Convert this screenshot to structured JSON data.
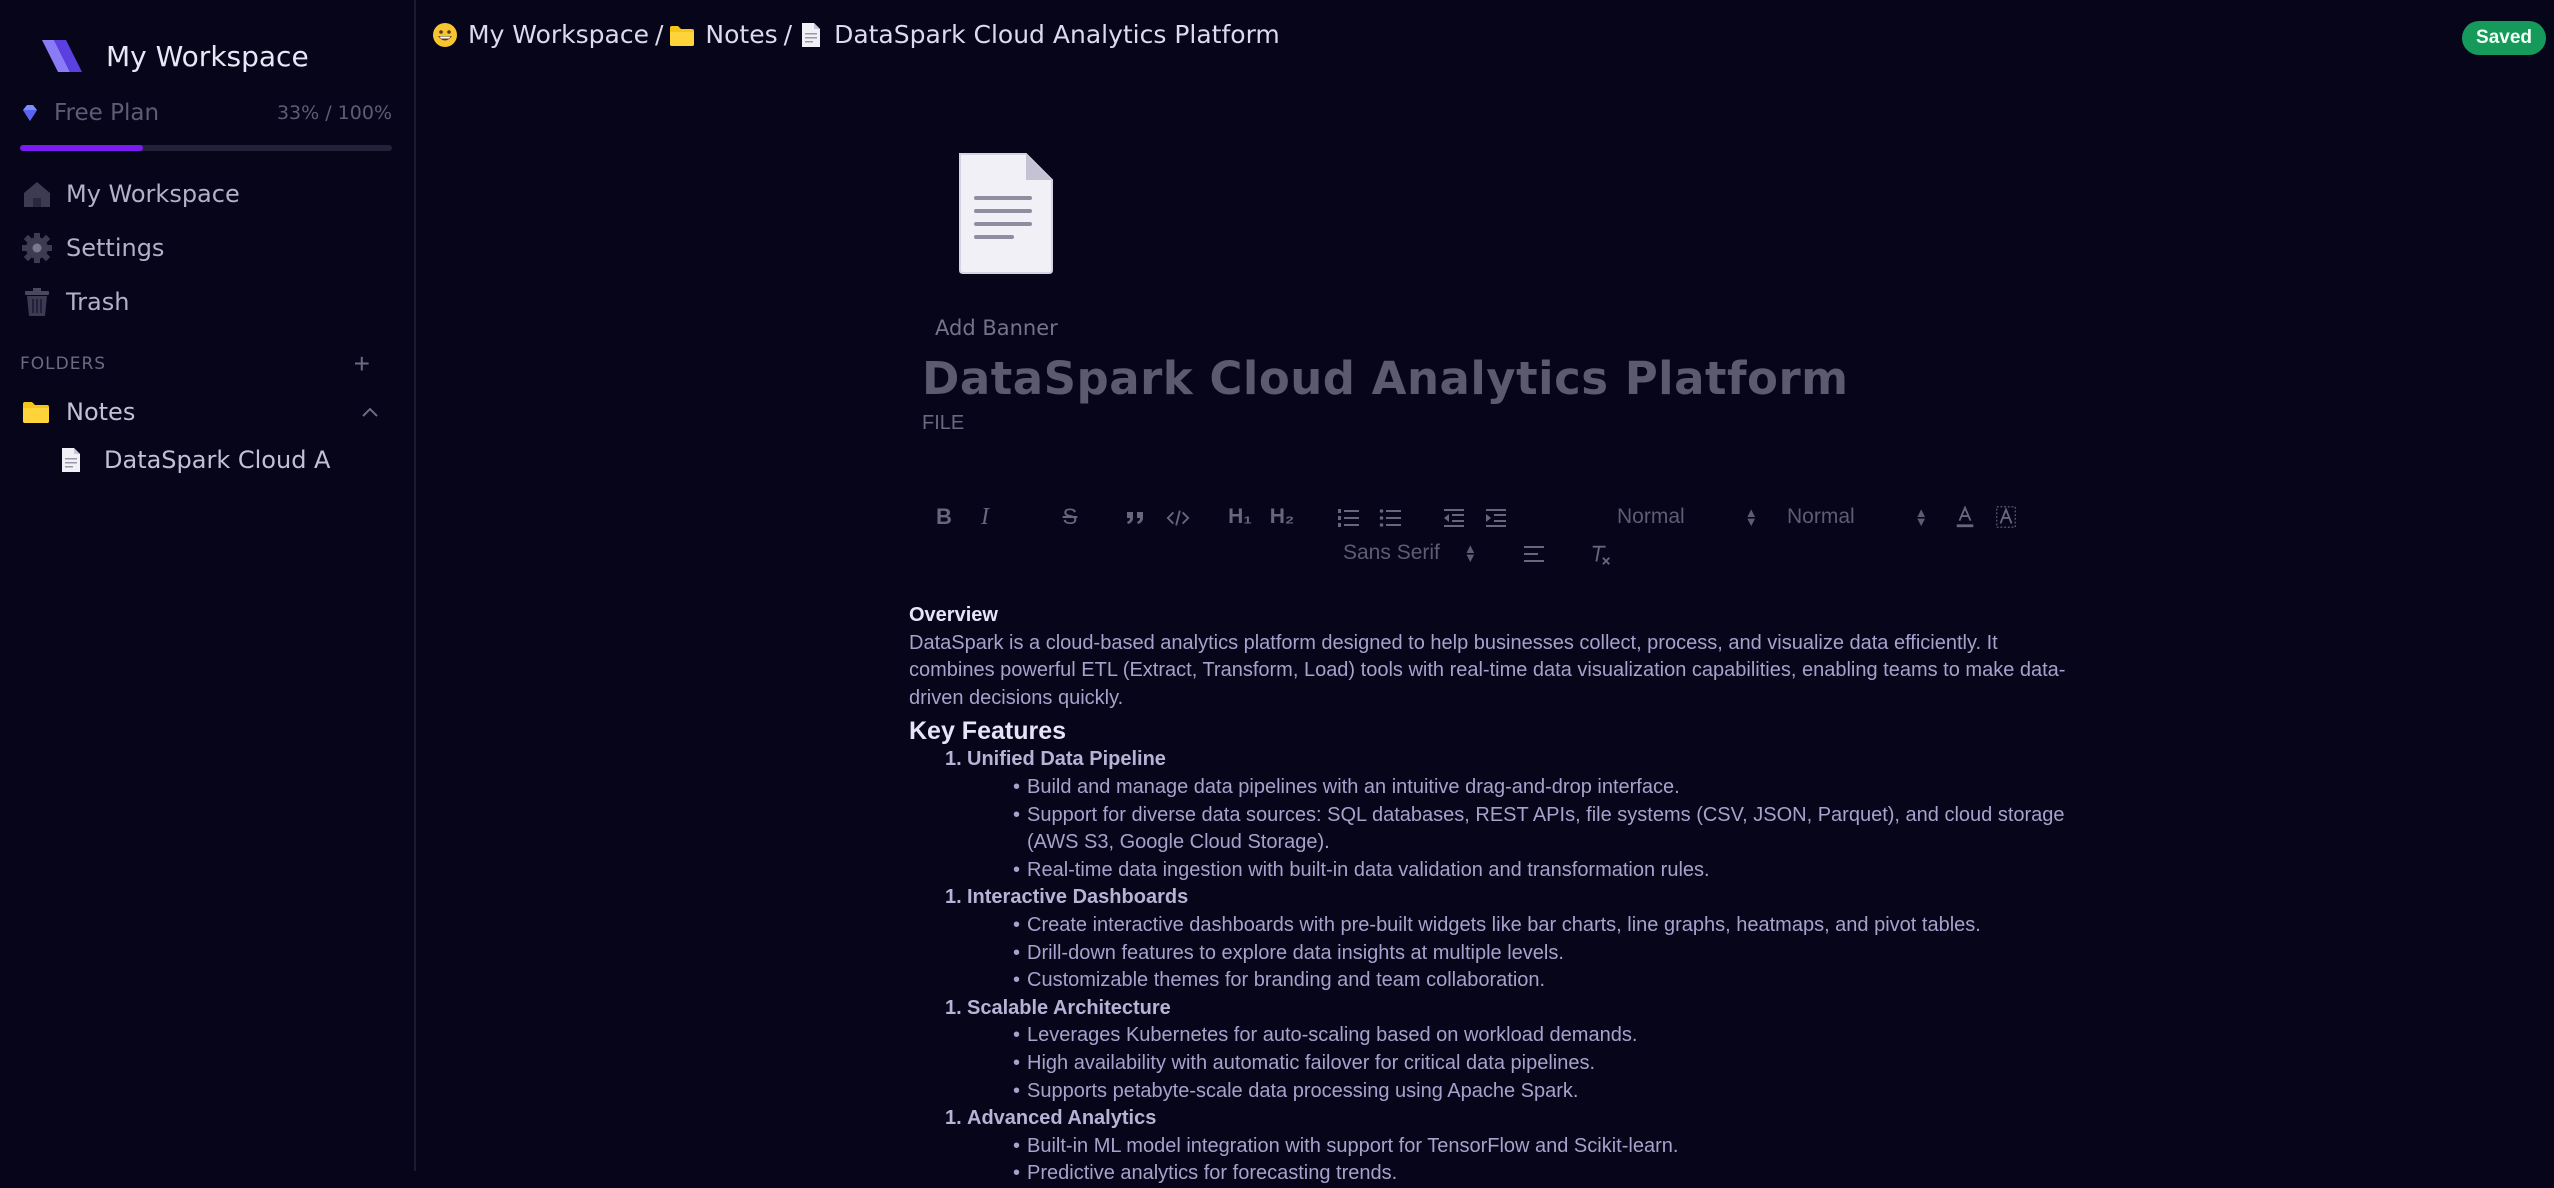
{
  "sidebar": {
    "workspace_title": "My Workspace",
    "plan_label": "Free Plan",
    "plan_usage": "33% / 100%",
    "plan_progress": 0.33,
    "nav": [
      {
        "label": "My Workspace",
        "icon": "home-icon"
      },
      {
        "label": "Settings",
        "icon": "gear-icon"
      },
      {
        "label": "Trash",
        "icon": "trash-icon"
      }
    ],
    "folders_label": "FOLDERS",
    "folders_add": "+",
    "folder": {
      "label": "Notes",
      "icon": "folder-icon"
    },
    "file": {
      "label": "DataSpark Cloud A",
      "icon": "file-icon"
    }
  },
  "breadcrumb": {
    "workspace": "My Workspace",
    "folder": "Notes",
    "file": "DataSpark Cloud Analytics Platform",
    "separator": "/"
  },
  "status": {
    "saved": "Saved",
    "color": "#169a5c"
  },
  "doc": {
    "add_banner": "Add Banner",
    "title": "DataSpark Cloud Analytics Platform",
    "kind": "FILE"
  },
  "toolbar": {
    "header_select": "Normal",
    "size_select": "Normal",
    "font_select": "Sans Serif",
    "h1": "H₁",
    "h2": "H₂"
  },
  "content": {
    "overview_heading": "Overview",
    "overview_text": "DataSpark is a cloud-based analytics platform designed to help businesses collect, process, and visualize data efficiently. It combines powerful ETL (Extract, Transform, Load) tools with real-time data visualization capabilities, enabling teams to make data-driven decisions quickly.",
    "key_heading": "Key Features",
    "features": [
      {
        "num": "1.",
        "title": "Unified Data Pipeline",
        "bullets": [
          "Build and manage data pipelines with an intuitive drag-and-drop interface.",
          "Support for diverse data sources: SQL databases, REST APIs, file systems (CSV, JSON, Parquet), and cloud storage (AWS S3, Google Cloud Storage).",
          "Real-time data ingestion with built-in data validation and transformation rules."
        ]
      },
      {
        "num": "1.",
        "title": "Interactive Dashboards",
        "bullets": [
          "Create interactive dashboards with pre-built widgets like bar charts, line graphs, heatmaps, and pivot tables.",
          "Drill-down features to explore data insights at multiple levels.",
          "Customizable themes for branding and team collaboration."
        ]
      },
      {
        "num": "1.",
        "title": "Scalable Architecture",
        "bullets": [
          "Leverages Kubernetes for auto-scaling based on workload demands.",
          "High availability with automatic failover for critical data pipelines.",
          "Supports petabyte-scale data processing using Apache Spark."
        ]
      },
      {
        "num": "1.",
        "title": "Advanced Analytics",
        "bullets": [
          "Built-in ML model integration with support for TensorFlow and Scikit-learn.",
          "Predictive analytics for forecasting trends."
        ]
      }
    ]
  }
}
